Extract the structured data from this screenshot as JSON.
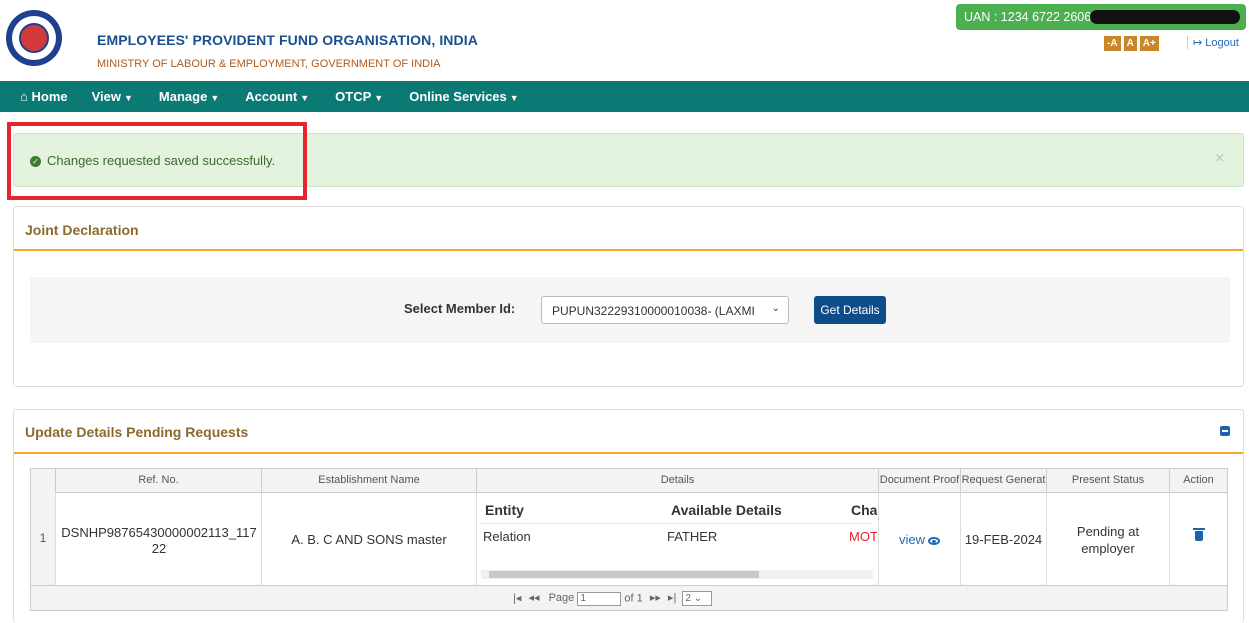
{
  "header": {
    "org_name": "EMPLOYEES' PROVIDENT FUND ORGANISATION, INDIA",
    "ministry": "MINISTRY OF LABOUR & EMPLOYMENT, GOVERNMENT OF INDIA",
    "uan_label": "UAN : 1234 6722 2606 /",
    "font_buttons": [
      "-A",
      "A",
      "A+"
    ],
    "logout_label": "Logout"
  },
  "nav": {
    "items": [
      {
        "label": "Home",
        "icon": "home-icon"
      },
      {
        "label": "View"
      },
      {
        "label": "Manage"
      },
      {
        "label": "Account"
      },
      {
        "label": "OTCP"
      },
      {
        "label": "Online Services"
      }
    ]
  },
  "alert": {
    "message": "Changes requested saved successfully.",
    "close": "×"
  },
  "joint_declaration": {
    "title": "Joint Declaration",
    "select_label": "Select Member Id:",
    "select_value": "PUPUN32229310000010038- (LAXMI",
    "button_label": "Get Details"
  },
  "pending": {
    "title": "Update Details Pending Requests",
    "columns": [
      "Ref. No.",
      "Establishment Name",
      "Details",
      "Document Proof",
      "Request Generat",
      "Present Status",
      "Action"
    ],
    "row": {
      "num": "1",
      "ref_no": "DSNHP98765430000002113_11722",
      "establishment": "A. B. C AND SONS master",
      "details_headers": [
        "Entity",
        "Available Details",
        "Cha"
      ],
      "details_values": [
        "Relation",
        "FATHER",
        "MOT"
      ],
      "doc_link": "view",
      "request_date": "19-FEB-2024",
      "status": "Pending at employer"
    },
    "pager": {
      "page_label": "Page",
      "page_value": "1",
      "of_label": "of 1",
      "rows_value": "2"
    }
  },
  "colors": {
    "nav_bg": "#0b7a75",
    "alert_bg": "#e3f3de",
    "accent": "#f5a623",
    "highlight": "#e3262e"
  }
}
